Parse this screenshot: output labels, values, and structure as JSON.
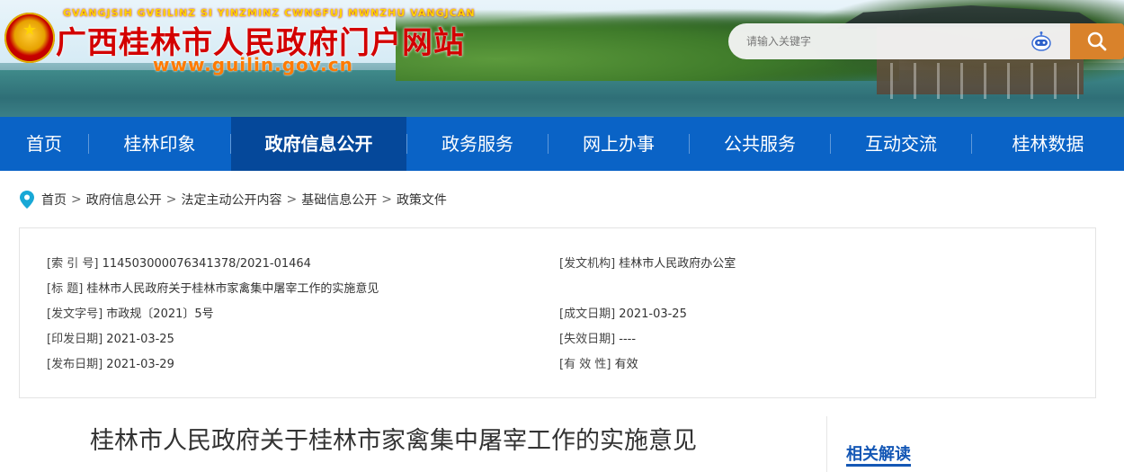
{
  "header": {
    "pinyin": "GVANGJSIH GVEILINZ SI YINZMINZ CWNGFUJ MWNZHU VANGJCAN",
    "title": "广西桂林市人民政府门户网站",
    "url": "www.guilin.gov.cn",
    "emblem_icon": "national-emblem-icon",
    "search": {
      "placeholder": "请输入关键字",
      "robot_icon": "robot-assistant-icon",
      "button_icon": "search-icon",
      "button_color": "#d9822b"
    }
  },
  "nav": {
    "color": "#0a63c6",
    "active_color": "#05489a",
    "items": [
      {
        "label": "首页"
      },
      {
        "label": "桂林印象"
      },
      {
        "label": "政府信息公开"
      },
      {
        "label": "政务服务"
      },
      {
        "label": "网上办事"
      },
      {
        "label": "公共服务"
      },
      {
        "label": "互动交流"
      },
      {
        "label": "桂林数据"
      }
    ],
    "active_index": 2
  },
  "breadcrumb": {
    "icon": "location-pin-icon",
    "separator": ">",
    "items": [
      "首页",
      "政府信息公开",
      "法定主动公开内容",
      "基础信息公开",
      "政策文件"
    ]
  },
  "meta": {
    "left": [
      {
        "label": "[索  引  号]",
        "value": "114503000076341378/2021-01464"
      },
      {
        "label": "[标      题]",
        "value": "桂林市人民政府关于桂林市家禽集中屠宰工作的实施意见"
      },
      {
        "label": "[发文字号]",
        "value": "市政规〔2021〕5号"
      },
      {
        "label": "[印发日期]",
        "value": "2021-03-25"
      },
      {
        "label": "[发布日期]",
        "value": "2021-03-29"
      }
    ],
    "right": [
      {
        "label": "[发文机构]",
        "value": "桂林市人民政府办公室"
      },
      {
        "label": "",
        "value": ""
      },
      {
        "label": "[成文日期]",
        "value": "2021-03-25"
      },
      {
        "label": "[失效日期]",
        "value": "----"
      },
      {
        "label": "[有  效  性]",
        "value": "有效"
      }
    ]
  },
  "article": {
    "title": "桂林市人民政府关于桂林市家禽集中屠宰工作的实施意见"
  },
  "sidebar": {
    "related_title": "相关解读",
    "accent_color": "#1457b5"
  }
}
